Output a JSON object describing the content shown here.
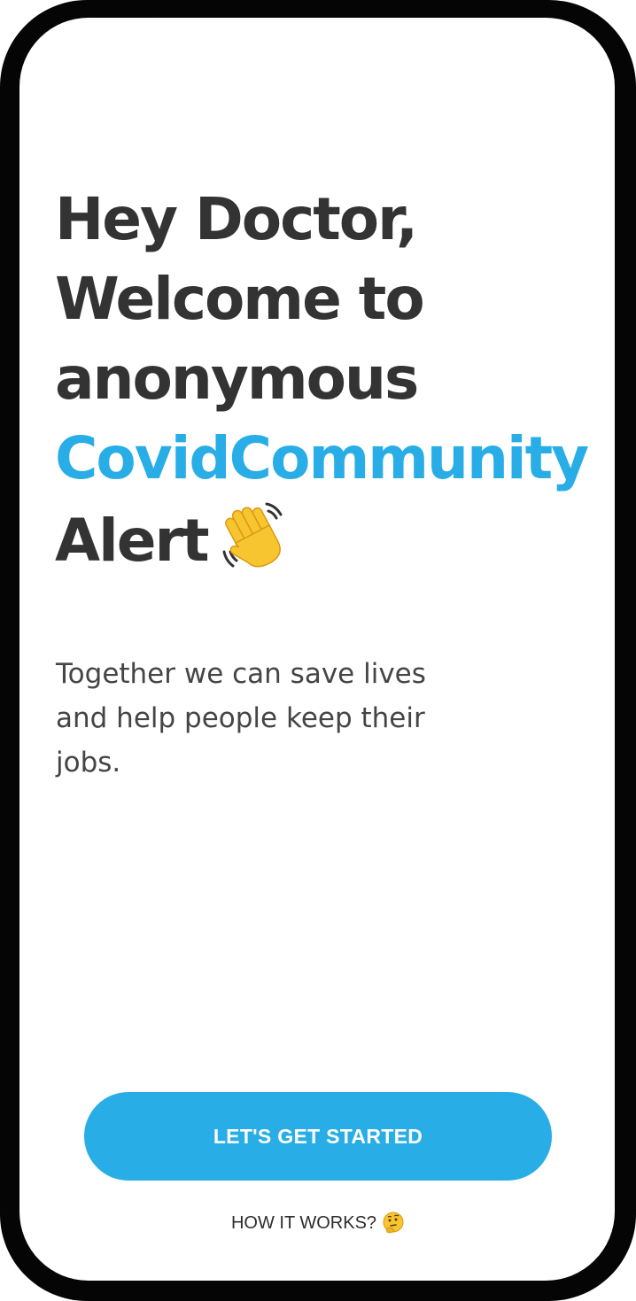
{
  "welcome": {
    "line1": "Hey Doctor,",
    "line2": "Welcome to",
    "line3": "anonymous",
    "brand": "CovidCommunity",
    "line5": "Alert",
    "wave_icon": "waving-hand-emoji"
  },
  "subtitle": "Together we can save lives and help people keep their jobs.",
  "primary_button": {
    "label": "LET'S GET STARTED"
  },
  "secondary_link": {
    "label": "HOW IT WORKS?",
    "icon": "thinking-face-emoji"
  },
  "colors": {
    "accent": "#28ade6",
    "heading": "#333333",
    "body_text": "#454545",
    "frame": "#050505",
    "background": "#ffffff"
  }
}
